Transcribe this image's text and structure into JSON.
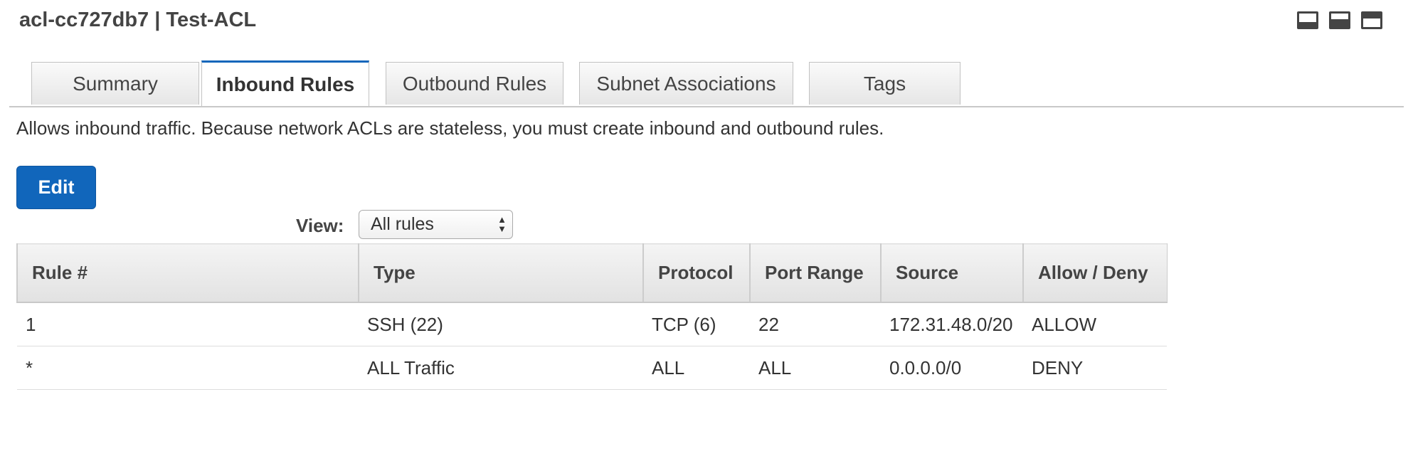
{
  "header": {
    "title": "acl-cc727db7 | Test-ACL",
    "view_icons": [
      "panel-bottom-icon",
      "panel-half-icon",
      "panel-full-icon"
    ]
  },
  "tabs": [
    {
      "label": "Summary",
      "active": false
    },
    {
      "label": "Inbound Rules",
      "active": true
    },
    {
      "label": "Outbound Rules",
      "active": false
    },
    {
      "label": "Subnet Associations",
      "active": false
    },
    {
      "label": "Tags",
      "active": false
    }
  ],
  "description": "Allows inbound traffic. Because network ACLs are stateless, you must create inbound and outbound rules.",
  "toolbar": {
    "edit_label": "Edit",
    "view_label": "View:",
    "view_value": "All rules"
  },
  "table": {
    "columns": [
      "Rule #",
      "Type",
      "Protocol",
      "Port Range",
      "Source",
      "Allow / Deny"
    ],
    "rows": [
      [
        "1",
        "SSH (22)",
        "TCP (6)",
        "22",
        "172.31.48.0/20",
        "ALLOW"
      ],
      [
        "*",
        "ALL Traffic",
        "ALL",
        "ALL",
        "0.0.0.0/0",
        "DENY"
      ]
    ]
  },
  "colors": {
    "accent": "#1166bb",
    "text": "#333333"
  }
}
